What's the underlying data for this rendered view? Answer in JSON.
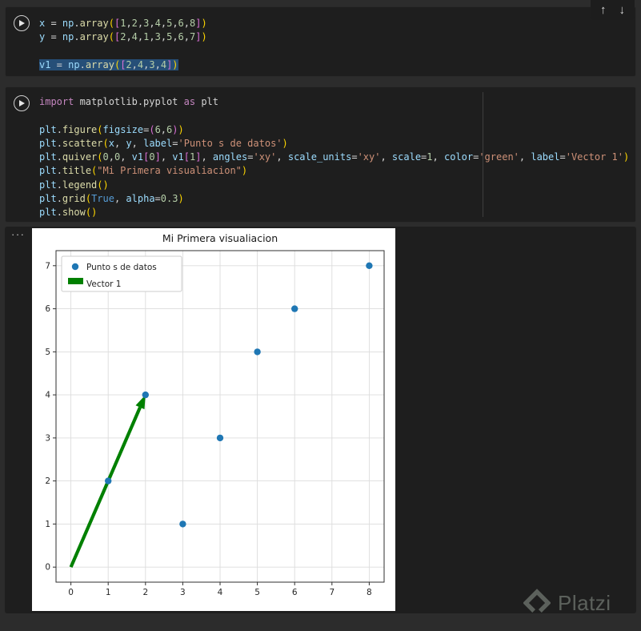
{
  "toolbar": {
    "up": "↑",
    "down": "↓"
  },
  "cells": [
    {
      "selected_line": 4,
      "lines": [
        [
          [
            "tv",
            "x"
          ],
          [
            "td",
            " = "
          ],
          [
            "tv",
            "np"
          ],
          [
            "td",
            "."
          ],
          [
            "tf",
            "array"
          ],
          [
            "tb1",
            "("
          ],
          [
            "tb2",
            "["
          ],
          [
            "tn",
            "1"
          ],
          [
            "td",
            ","
          ],
          [
            "tn",
            "2"
          ],
          [
            "td",
            ","
          ],
          [
            "tn",
            "3"
          ],
          [
            "td",
            ","
          ],
          [
            "tn",
            "4"
          ],
          [
            "td",
            ","
          ],
          [
            "tn",
            "5"
          ],
          [
            "td",
            ","
          ],
          [
            "tn",
            "6"
          ],
          [
            "td",
            ","
          ],
          [
            "tn",
            "8"
          ],
          [
            "tb2",
            "]"
          ],
          [
            "tb1",
            ")"
          ]
        ],
        [
          [
            "tv",
            "y"
          ],
          [
            "td",
            " = "
          ],
          [
            "tv",
            "np"
          ],
          [
            "td",
            "."
          ],
          [
            "tf",
            "array"
          ],
          [
            "tb1",
            "("
          ],
          [
            "tb2",
            "["
          ],
          [
            "tn",
            "2"
          ],
          [
            "td",
            ","
          ],
          [
            "tn",
            "4"
          ],
          [
            "td",
            ","
          ],
          [
            "tn",
            "1"
          ],
          [
            "td",
            ","
          ],
          [
            "tn",
            "3"
          ],
          [
            "td",
            ","
          ],
          [
            "tn",
            "5"
          ],
          [
            "td",
            ","
          ],
          [
            "tn",
            "6"
          ],
          [
            "td",
            ","
          ],
          [
            "tn",
            "7"
          ],
          [
            "tb2",
            "]"
          ],
          [
            "tb1",
            ")"
          ]
        ],
        [],
        [
          [
            "tv",
            "v1"
          ],
          [
            "td",
            " = "
          ],
          [
            "tv",
            "np"
          ],
          [
            "td",
            "."
          ],
          [
            "tf",
            "array"
          ],
          [
            "tb1",
            "("
          ],
          [
            "tb2",
            "["
          ],
          [
            "tn",
            "2"
          ],
          [
            "td",
            ","
          ],
          [
            "tn",
            "4"
          ],
          [
            "td",
            ","
          ],
          [
            "tn",
            "3"
          ],
          [
            "td",
            ","
          ],
          [
            "tn",
            "4"
          ],
          [
            "tb2",
            "]"
          ],
          [
            "tb1",
            ")"
          ]
        ]
      ]
    },
    {
      "selected_line": null,
      "lines": [
        [
          [
            "tk",
            "import"
          ],
          [
            "td",
            " matplotlib.pyplot "
          ],
          [
            "tk",
            "as"
          ],
          [
            "td",
            " plt"
          ]
        ],
        [],
        [
          [
            "tv",
            "plt"
          ],
          [
            "td",
            "."
          ],
          [
            "tf",
            "figure"
          ],
          [
            "tb1",
            "("
          ],
          [
            "tv",
            "figsize"
          ],
          [
            "td",
            "="
          ],
          [
            "tb2",
            "("
          ],
          [
            "tn",
            "6"
          ],
          [
            "td",
            ","
          ],
          [
            "tn",
            "6"
          ],
          [
            "tb2",
            ")"
          ],
          [
            "tb1",
            ")"
          ]
        ],
        [
          [
            "tv",
            "plt"
          ],
          [
            "td",
            "."
          ],
          [
            "tf",
            "scatter"
          ],
          [
            "tb1",
            "("
          ],
          [
            "tv",
            "x"
          ],
          [
            "td",
            ", "
          ],
          [
            "tv",
            "y"
          ],
          [
            "td",
            ", "
          ],
          [
            "tv",
            "label"
          ],
          [
            "td",
            "="
          ],
          [
            "ts",
            "'Punto s de datos'"
          ],
          [
            "tb1",
            ")"
          ]
        ],
        [
          [
            "tv",
            "plt"
          ],
          [
            "td",
            "."
          ],
          [
            "tf",
            "quiver"
          ],
          [
            "tb1",
            "("
          ],
          [
            "tn",
            "0"
          ],
          [
            "td",
            ","
          ],
          [
            "tn",
            "0"
          ],
          [
            "td",
            ", "
          ],
          [
            "tv",
            "v1"
          ],
          [
            "tb2",
            "["
          ],
          [
            "tn",
            "0"
          ],
          [
            "tb2",
            "]"
          ],
          [
            "td",
            ", "
          ],
          [
            "tv",
            "v1"
          ],
          [
            "tb2",
            "["
          ],
          [
            "tn",
            "1"
          ],
          [
            "tb2",
            "]"
          ],
          [
            "td",
            ", "
          ],
          [
            "tv",
            "angles"
          ],
          [
            "td",
            "="
          ],
          [
            "ts",
            "'xy'"
          ],
          [
            "td",
            ", "
          ],
          [
            "tv",
            "scale_units"
          ],
          [
            "td",
            "="
          ],
          [
            "ts",
            "'xy'"
          ],
          [
            "td",
            ", "
          ],
          [
            "tv",
            "scale"
          ],
          [
            "td",
            "="
          ],
          [
            "tn",
            "1"
          ],
          [
            "td",
            ", "
          ],
          [
            "tv",
            "color"
          ],
          [
            "td",
            "="
          ],
          [
            "ts",
            "'green'"
          ],
          [
            "td",
            ", "
          ],
          [
            "tv",
            "label"
          ],
          [
            "td",
            "="
          ],
          [
            "ts",
            "'Vector 1'"
          ],
          [
            "tb1",
            ")"
          ]
        ],
        [
          [
            "tv",
            "plt"
          ],
          [
            "td",
            "."
          ],
          [
            "tf",
            "title"
          ],
          [
            "tb1",
            "("
          ],
          [
            "ts",
            "\"Mi Primera visualiacion\""
          ],
          [
            "tb1",
            ")"
          ]
        ],
        [
          [
            "tv",
            "plt"
          ],
          [
            "td",
            "."
          ],
          [
            "tf",
            "legend"
          ],
          [
            "tb1",
            "("
          ],
          [
            "tb1",
            ")"
          ]
        ],
        [
          [
            "tv",
            "plt"
          ],
          [
            "td",
            "."
          ],
          [
            "tf",
            "grid"
          ],
          [
            "tb1",
            "("
          ],
          [
            "tc",
            "True"
          ],
          [
            "td",
            ", "
          ],
          [
            "tv",
            "alpha"
          ],
          [
            "td",
            "="
          ],
          [
            "tn",
            "0.3"
          ],
          [
            "tb1",
            ")"
          ]
        ],
        [
          [
            "tv",
            "plt"
          ],
          [
            "td",
            "."
          ],
          [
            "tf",
            "show"
          ],
          [
            "tb1",
            "("
          ],
          [
            "tb1",
            ")"
          ]
        ]
      ]
    }
  ],
  "output": {
    "menu_icon": "···"
  },
  "chart_data": {
    "type": "scatter",
    "title": "Mi Primera visualiacion",
    "points": {
      "x": [
        1,
        2,
        3,
        4,
        5,
        6,
        8
      ],
      "y": [
        2,
        4,
        1,
        3,
        5,
        6,
        7
      ],
      "color": "#1f77b4",
      "label": "Punto s de datos"
    },
    "vector": {
      "from": [
        0,
        0
      ],
      "to": [
        2,
        4
      ],
      "color": "#008000",
      "label": "Vector 1"
    },
    "xlim": [
      -0.4,
      8.4
    ],
    "ylim": [
      -0.35,
      7.35
    ],
    "xticks": [
      0,
      1,
      2,
      3,
      4,
      5,
      6,
      7,
      8
    ],
    "yticks": [
      0,
      1,
      2,
      3,
      4,
      5,
      6,
      7
    ],
    "grid": true,
    "grid_alpha": 0.3,
    "legend_position": "upper left"
  },
  "watermark": {
    "text": "Platzi"
  }
}
